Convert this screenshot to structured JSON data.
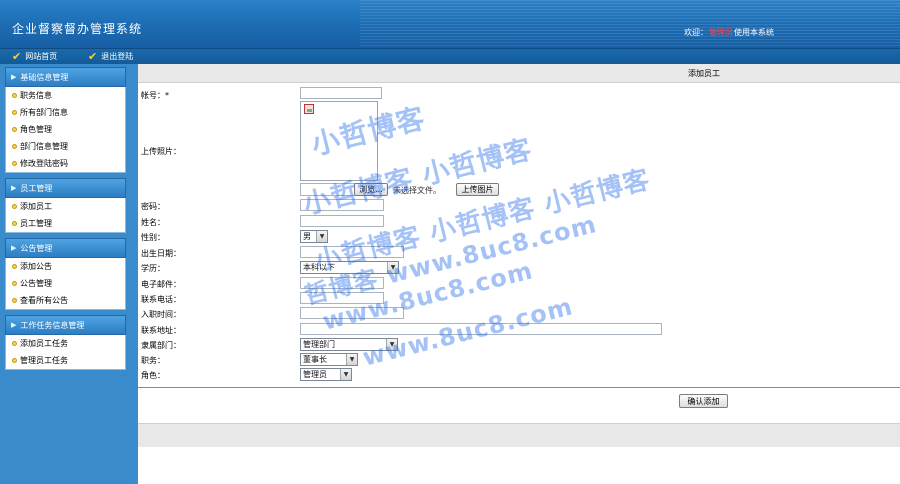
{
  "app": {
    "title": "企业督察督办管理系统"
  },
  "header": {
    "welcome_prefix": "欢迎",
    "username": "管理员",
    "welcome_suffix": "使用本系统"
  },
  "nav": {
    "home_label": "网站首页",
    "logout_label": "退出登陆"
  },
  "sidebar": {
    "groups": [
      {
        "title": "基础信息管理",
        "items": [
          "职务信息",
          "所有部门信息",
          "角色管理",
          "部门信息管理",
          "修改登陆密码"
        ]
      },
      {
        "title": "员工管理",
        "items": [
          "添加员工",
          "员工管理"
        ]
      },
      {
        "title": "公告管理",
        "items": [
          "添加公告",
          "公告管理",
          "查看所有公告"
        ]
      },
      {
        "title": "工作任务信息管理",
        "items": [
          "添加员工任务",
          "管理员工任务"
        ]
      }
    ]
  },
  "form": {
    "panel_title": "添加员工",
    "labels": {
      "account": "帐号：*",
      "photo": "上传照片：",
      "password": "密码：",
      "name": "姓名：",
      "gender": "性别：",
      "birthday": "出生日期：",
      "education": "学历：",
      "email": "电子邮件：",
      "phone": "联系电话：",
      "hire_date": "入职时间：",
      "address": "联系地址：",
      "department": "隶属部门：",
      "position": "职务：",
      "role": "角色："
    },
    "browse_button": "浏览...",
    "no_file_text": "未选择文件。",
    "upload_button": "上传图片",
    "gender_value": "男",
    "education_value": "本科以下",
    "department_value": "管理部门",
    "position_value": "董事长",
    "role_value": "管理员",
    "submit_button": "确认添加"
  },
  "watermarks": [
    "小哲博客",
    "小哲博客 小哲博客",
    "小哲博客 小哲博客 小哲博客",
    "小哲博客 www.8uc8.com",
    "哲博客 www.8uc8.com",
    "www.8uc8.com",
    "www.8uc8.com"
  ],
  "colors": {
    "header": "#1e6fb6",
    "sidebar": "#3a8bcb",
    "welcome_user": "#ff4040",
    "check": "#f3d23a",
    "watermark": "#286eeb"
  }
}
